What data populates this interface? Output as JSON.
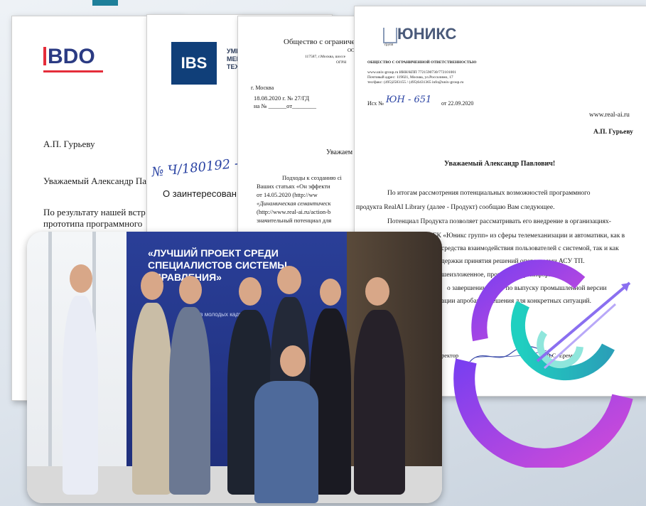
{
  "doc_bdo": {
    "logo": "BDO",
    "addressee": "А.П. Гурьеву",
    "greeting": "Уважаемый Александр Па",
    "body_line1": "По результату нашей встр",
    "body_line2": "прототипа программного"
  },
  "doc_ibs": {
    "logo": "IBS",
    "side_line1": "УМН",
    "side_line2": "МЕН",
    "side_line3": "ТЕХ",
    "handwritten": "№ Ч/180192 - 0",
    "heading": "О заинтересован"
  },
  "doc_ooo": {
    "org": "Общество с ограничен",
    "org2": "ОО",
    "small1": "117587, г.Москва, шоссе",
    "small2": "ОГРН",
    "city": "г. Москва",
    "date_no": "18.08.2020 г.  № 27/ГД",
    "na_no": "на № ______от________",
    "greet": "Уважаем",
    "p1": "Подходы к созданию сі",
    "p2": "Ваших статьях «Он эффекти",
    "p3": "от    14.05.2020    (http://ww",
    "p4": "«Динамическая семантическ",
    "p5": "(http://www.real-ai.ru/action-b",
    "p6": "значительный потенциал для"
  },
  "doc_unix": {
    "logo": "ЮНИКС",
    "logo_sub": "групп",
    "org": "ОБЩЕСТВО С ОГРАНИЧЕННОЙ ОТВЕТСТВЕННОСТЬЮ",
    "small1": "www.unix-group.ru  ИНН/КПП 7721590730/772101001",
    "small2": "Почтовый адрес: 119021, Москва, ул.Россолимо, 17",
    "small3": "тел/факс: (495)2583155 / (495)6431365  info@unix-group.ru",
    "ref_prefix": "Исх №",
    "ref_hand": "ЮН - 651",
    "ref_date": "от 22.09.2020",
    "site": "www.real-ai.ru",
    "addressee": "А.П. Гурьеву",
    "greeting": "Уважаемый Александр Павлович!",
    "l1": "По итогам рассмотрения потенциальных возможностей программного",
    "l2": "продукта RealAI Library (далее - Продукт) сообщаю Вам следующее.",
    "l3": "Потенциал Продукта позволяет рассматривать его внедрение в организациях-",
    "l4": "ГК «Юникс групп» из сферы телемеханизации и автоматики, как в",
    "l5": "средства взаимодействия пользователей с системой, так и как",
    "l6": "держки принятия решений операторами АСУ ТП.",
    "l7": "шеизложенное,       прошу       Вас       проинформировать",
    "l8": "о завершении работ по выпуску промышленной версии",
    "l9": "ации апробации решения для конкретных ситуаций.",
    "sign_left": "ректор",
    "sign_right": "В.С. Еремин"
  },
  "photo": {
    "banner": "«ЛУЧШИЙ ПРОЕКТ СРЕДИ СПЕЦИАЛИСТОВ СИСТЕМЫ УПРАВЛЕНИЯ»",
    "banner_sub": "проектов молодых кадров"
  },
  "colors": {
    "bdo_blue": "#2b3b83",
    "bdo_red": "#e52d3a",
    "ibs_blue": "#103f79",
    "banner_blue": "#2a3f98",
    "ring_teal": "#21c0b0",
    "ring_purple": "#8a3ff0",
    "ring_magenta": "#d04bd8"
  }
}
